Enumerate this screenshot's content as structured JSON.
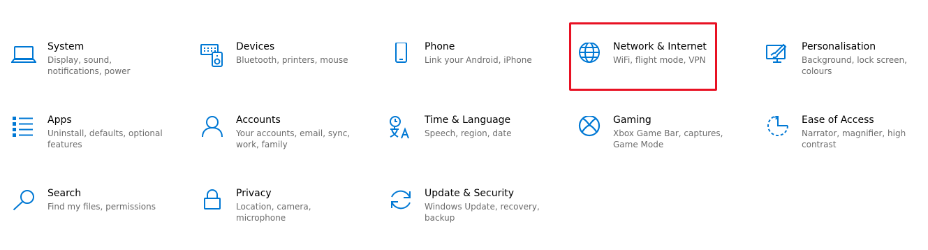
{
  "accent_color": "#0078d4",
  "highlight_color": "#e81123",
  "tiles": [
    {
      "title": "System",
      "desc": "Display, sound, notifications, power",
      "icon": "laptop-icon"
    },
    {
      "title": "Devices",
      "desc": "Bluetooth, printers, mouse",
      "icon": "devices-icon"
    },
    {
      "title": "Phone",
      "desc": "Link your Android, iPhone",
      "icon": "phone-icon"
    },
    {
      "title": "Network & Internet",
      "desc": "WiFi, flight mode, VPN",
      "icon": "globe-icon"
    },
    {
      "title": "Personalisation",
      "desc": "Background, lock screen, colours",
      "icon": "paint-icon"
    },
    {
      "title": "Apps",
      "desc": "Uninstall, defaults, optional features",
      "icon": "apps-list-icon"
    },
    {
      "title": "Accounts",
      "desc": "Your accounts, email, sync, work, family",
      "icon": "person-icon"
    },
    {
      "title": "Time & Language",
      "desc": "Speech, region, date",
      "icon": "time-language-icon"
    },
    {
      "title": "Gaming",
      "desc": "Xbox Game Bar, captures, Game Mode",
      "icon": "xbox-icon"
    },
    {
      "title": "Ease of Access",
      "desc": "Narrator, magnifier, high contrast",
      "icon": "ease-of-access-icon"
    },
    {
      "title": "Search",
      "desc": "Find my files, permissions",
      "icon": "search-icon"
    },
    {
      "title": "Privacy",
      "desc": "Location, camera, microphone",
      "icon": "lock-icon"
    },
    {
      "title": "Update & Security",
      "desc": "Windows Update, recovery, backup",
      "icon": "sync-icon"
    }
  ]
}
